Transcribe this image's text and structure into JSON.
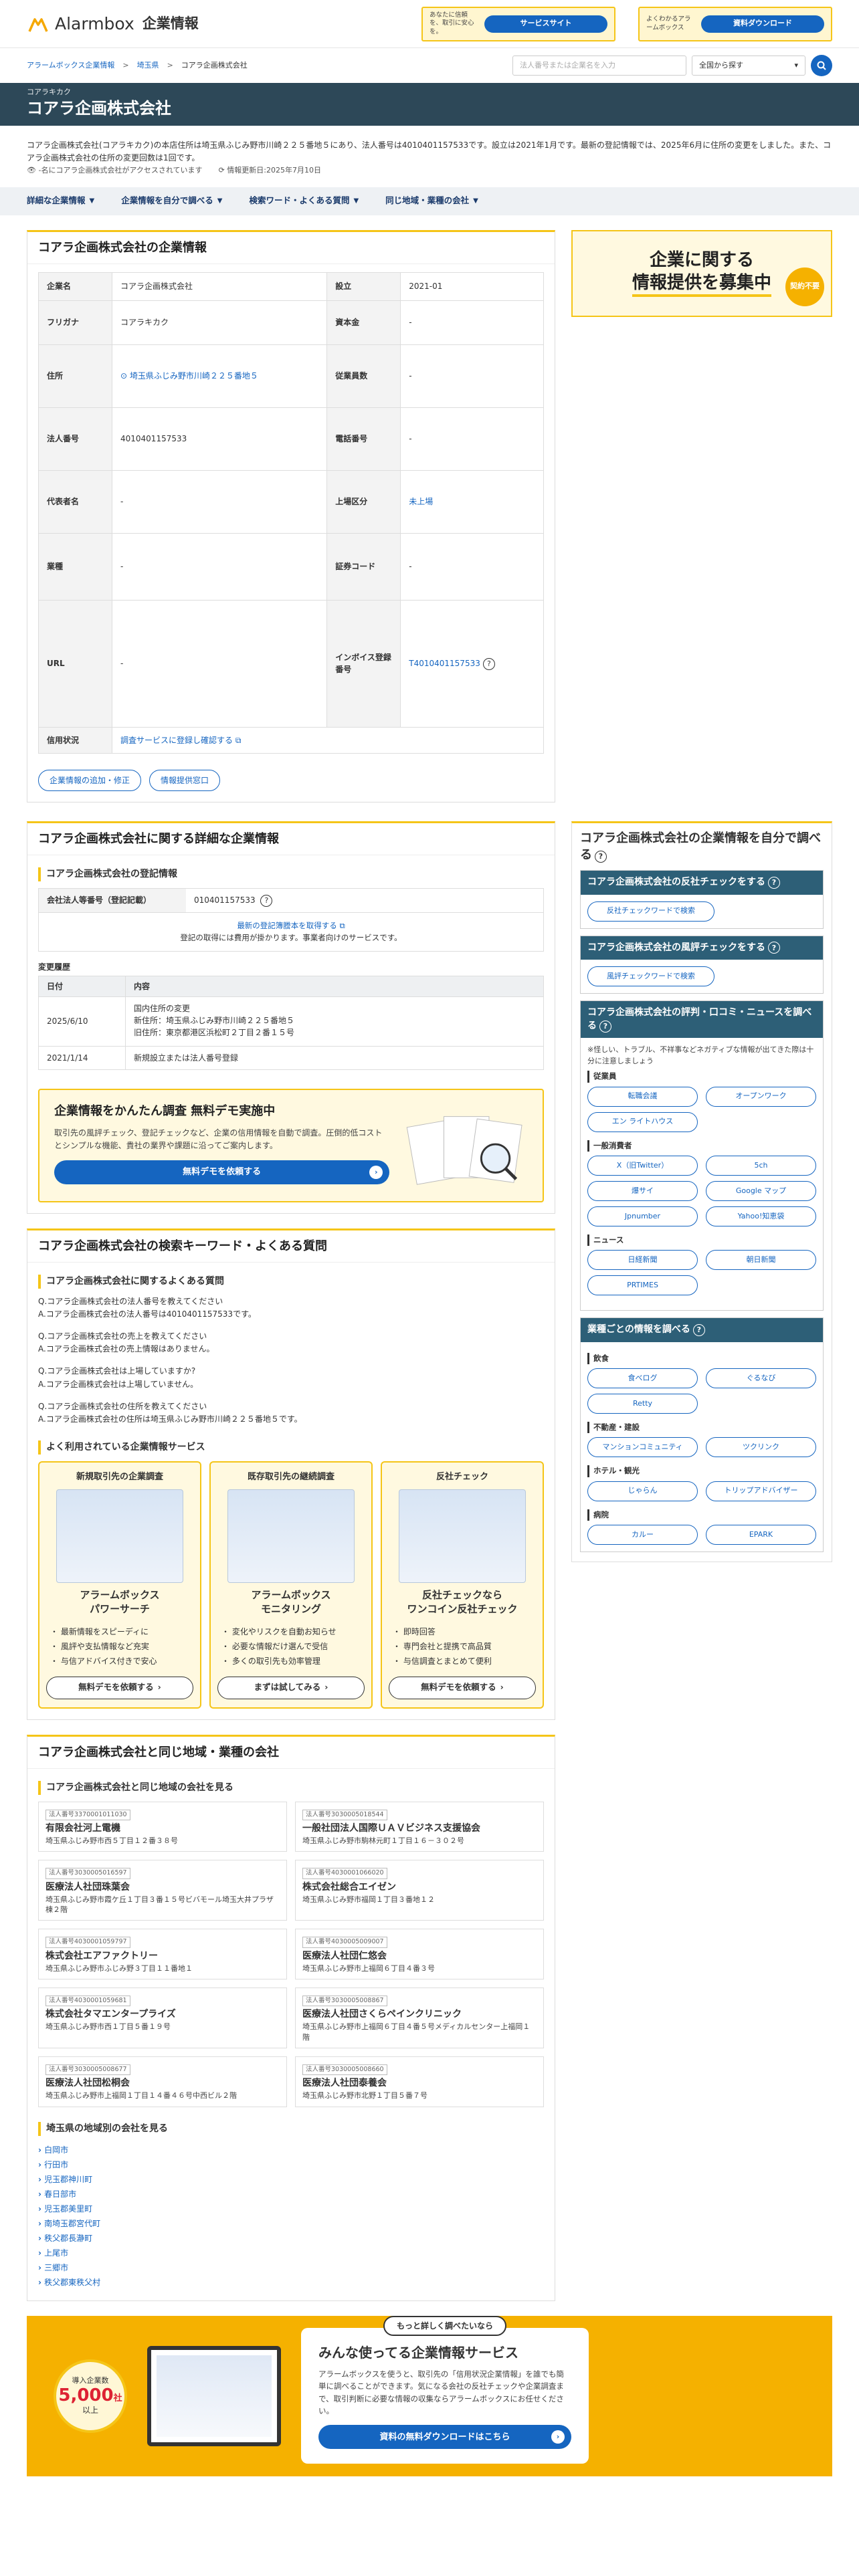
{
  "header": {
    "brand": "Alarmbox",
    "section": "企業情報",
    "banner1_text": "あなたに信頼を、取引に安心を。",
    "banner1_button": "サービスサイト",
    "banner2_text": "よくわかるアラームボックス",
    "banner2_button": "資料ダウンロード"
  },
  "breadcrumb": [
    "アラームボックス企業情報",
    "埼玉県",
    "コアラ企画株式会社"
  ],
  "search": {
    "placeholder": "法人番号または企業名を入力",
    "scope": "全国から探す"
  },
  "company": {
    "kana": "コアラキカク",
    "name": "コアラ企画株式会社"
  },
  "intro": {
    "text": "コアラ企画株式会社(コアラキカク)の本店住所は埼玉県ふじみ野市川崎２２５番地５にあり、法人番号は4010401157533です。設立は2021年1月です。最新の登記情報では、2025年6月に住所の変更をしました。また、コアラ企画株式会社の住所の変更回数は1回です。",
    "views": "-名にコアラ企画株式会社がアクセスされています",
    "updated": "情報更新日:2025年7月10日"
  },
  "tabs": [
    "詳細な企業情報",
    "企業情報を自分で調べる",
    "検索ワード・よくある質問",
    "同じ地域・業種の会社"
  ],
  "info_card": {
    "title": "コアラ企画株式会社の企業情報",
    "rows": [
      {
        "k1": "企業名",
        "v1": "コアラ企画株式会社",
        "k2": "設立",
        "v2": "2021-01"
      },
      {
        "k1": "フリガナ",
        "v1": "コアラキカク",
        "k2": "資本金",
        "v2": "-"
      },
      {
        "k1": "住所",
        "v1": "埼玉県ふじみ野市川崎２２５番地５",
        "k2": "従業員数",
        "v2": "-"
      },
      {
        "k1": "法人番号",
        "v1": "4010401157533",
        "k2": "電話番号",
        "v2": "-"
      },
      {
        "k1": "代表者名",
        "v1": "-",
        "k2": "上場区分",
        "v2": "未上場"
      },
      {
        "k1": "業種",
        "v1": "-",
        "k2": "証券コード",
        "v2": "-"
      },
      {
        "k1": "URL",
        "v1": "-",
        "k2": "インボイス登録番号",
        "v2": "T4010401157533"
      }
    ],
    "credit_label": "信用状況",
    "credit_value": "調査サービスに登録し確認する",
    "buttons": [
      "企業情報の追加・修正",
      "情報提供窓口"
    ]
  },
  "detail_card": {
    "title": "コアラ企画株式会社に関する詳細な企業情報",
    "sub": "コアラ企画株式会社の登記情報",
    "reg_label": "会社法人等番号（登記記載）",
    "reg_value": "010401157533",
    "reg_link": "最新の登記簿謄本を取得する",
    "reg_note": "登記の取得には費用が掛かります。事業者向けのサービスです。",
    "hist_title": "変更履歴",
    "hist_headers": [
      "日付",
      "内容"
    ],
    "history": [
      {
        "date": "2025/6/10",
        "content": "国内住所の変更\n新住所：埼玉県ふじみ野市川崎２２５番地５\n旧住所：東京都港区浜松町２丁目２番１５号"
      },
      {
        "date": "2021/1/14",
        "content": "新規設立または法人番号登録"
      }
    ]
  },
  "promo": {
    "title": "企業情報をかんたん調査 無料デモ実施中",
    "text": "取引先の風評チェック、登記チェックなど、企業の信用情報を自動で調査。圧倒的低コストとシンプルな機能、貴社の業界や課題に沿ってご案内します。",
    "button": "無料デモを依頼する"
  },
  "faq_card": {
    "title": "コアラ企画株式会社の検索キーワード・よくある質問",
    "sub": "コアラ企画株式会社に関するよくある質問",
    "qa": [
      {
        "q": "Q.コアラ企画株式会社の法人番号を教えてください",
        "a": "A.コアラ企画株式会社の法人番号は4010401157533です。"
      },
      {
        "q": "Q.コアラ企画株式会社の売上を教えてください",
        "a": "A.コアラ企画株式会社の売上情報はありません。"
      },
      {
        "q": "Q.コアラ企画株式会社は上場していますか?",
        "a": "A.コアラ企画株式会社は上場していません。"
      },
      {
        "q": "Q.コアラ企画株式会社の住所を教えてください",
        "a": "A.コアラ企画株式会社の住所は埼玉県ふじみ野市川崎２２５番地５です。"
      }
    ],
    "svc_title": "よく利用されている企業情報サービス",
    "services": [
      {
        "tag": "新規取引先の企業調査",
        "name": "アラームボックス\nパワーサーチ",
        "points": [
          "最新情報をスピーディに",
          "風評や支払情報など充実",
          "与信アドバイス付きで安心"
        ],
        "button": "無料デモを依頼する"
      },
      {
        "tag": "既存取引先の継続調査",
        "name": "アラームボックス\nモニタリング",
        "points": [
          "変化やリスクを自動お知らせ",
          "必要な情報だけ選んで受信",
          "多くの取引先も効率管理"
        ],
        "button": "まずは試してみる"
      },
      {
        "tag": "反社チェック",
        "name": "反社チェックなら\nワンコイン反社チェック",
        "points": [
          "即時回答",
          "専門会社と提携で高品質",
          "与信調査とまとめて便利"
        ],
        "button": "無料デモを依頼する"
      }
    ]
  },
  "same_area": {
    "title": "コアラ企画株式会社と同じ地域・業種の会社",
    "sub": "コアラ企画株式会社と同じ地域の会社を見る",
    "companies": [
      {
        "num": "法人番号3370001011030",
        "name": "有限会社河上電機",
        "addr": "埼玉県ふじみ野市西５丁目１２番３８号"
      },
      {
        "num": "法人番号3030005018544",
        "name": "一般社団法人国際ＵＡＶビジネス支援協会",
        "addr": "埼玉県ふじみ野市駒林元町１丁目１６－３０２号"
      },
      {
        "num": "法人番号3030005016597",
        "name": "医療法人社団珠葉会",
        "addr": "埼玉県ふじみ野市霞ケ丘１丁目３番１５号ビバモール埼玉大井プラザ棟２階"
      },
      {
        "num": "法人番号4030001066020",
        "name": "株式会社総合エイゼン",
        "addr": "埼玉県ふじみ野市福岡１丁目３番地１２"
      },
      {
        "num": "法人番号4030001059797",
        "name": "株式会社エアファクトリー",
        "addr": "埼玉県ふじみ野市ふじみ野３丁目１１番地１"
      },
      {
        "num": "法人番号4030005009007",
        "name": "医療法人社団仁悠会",
        "addr": "埼玉県ふじみ野市上福岡６丁目４番３号"
      },
      {
        "num": "法人番号4030001059681",
        "name": "株式会社タマエンタープライズ",
        "addr": "埼玉県ふじみ野市西１丁目５番１９号"
      },
      {
        "num": "法人番号3030005008867",
        "name": "医療法人社団さくらペインクリニック",
        "addr": "埼玉県ふじみ野市上福岡６丁目４番５号メディカルセンター上福岡１階"
      },
      {
        "num": "法人番号3030005008677",
        "name": "医療法人社団松桐会",
        "addr": "埼玉県ふじみ野市上福岡１丁目１４番４６号中西ビル２階"
      },
      {
        "num": "法人番号3030005008660",
        "name": "医療法人社団泰養会",
        "addr": "埼玉県ふじみ野市北野１丁目５番７号"
      }
    ],
    "area_title": "埼玉県の地域別の会社を見る",
    "areas": [
      "白岡市",
      "行田市",
      "児玉郡神川町",
      "春日部市",
      "児玉郡美里町",
      "南埼玉郡宮代町",
      "秩父郡長瀞町",
      "上尾市",
      "三郷市",
      "秩父郡東秩父村"
    ]
  },
  "side": {
    "ad_line1": "企業に関する",
    "ad_line2": "情報提供を募集中",
    "ad_badge": "契約不要",
    "title": "コアラ企画株式会社の企業情報を自分で調べる",
    "box1_title": "コアラ企画株式会社の反社チェックをする",
    "box1_btn": "反社チェックワードで検索",
    "box2_title": "コアラ企画株式会社の風評チェックをする",
    "box2_btn": "風評チェックワードで検索",
    "box3_title": "コアラ企画株式会社の評判・口コミ・ニュースを調べる",
    "box3_note": "※怪しい、トラブル、不祥事などネガティブな情報が出てきた際は十分に注意しましょう",
    "groups": [
      {
        "label": "従業員",
        "items": [
          "転職会議",
          "オープンワーク",
          "エン ライトハウス"
        ]
      },
      {
        "label": "一般消費者",
        "items": [
          "X（旧Twitter）",
          "5ch",
          "爆サイ",
          "Google マップ",
          "Jpnumber",
          "Yahoo!知恵袋"
        ]
      },
      {
        "label": "ニュース",
        "items": [
          "日経新聞",
          "朝日新聞",
          "PRTIMES"
        ]
      }
    ],
    "box4_title": "業種ごとの情報を調べる",
    "groups2": [
      {
        "label": "飲食",
        "items": [
          "食べログ",
          "ぐるなび",
          "Retty"
        ]
      },
      {
        "label": "不動産・建設",
        "items": [
          "マンションコミュニティ",
          "ツクリンク"
        ]
      },
      {
        "label": "ホテル・観光",
        "items": [
          "じゃらん",
          "トリップアドバイザー"
        ]
      },
      {
        "label": "病院",
        "items": [
          "カルー",
          "EPARK"
        ]
      }
    ]
  },
  "cta": {
    "badge_top": "導入企業数",
    "badge_num": "5,000",
    "badge_unit": "社",
    "badge_bottom": "以上",
    "tag": "もっと詳しく調べたいなら",
    "title": "みんな使ってる企業情報サービス",
    "text": "アラームボックスを使うと、取引先の「信用状況企業情報」を誰でも簡単に調べることができます。気になる会社の反社チェックや企業調査まで、取引判断に必要な情報の収集ならアラームボックスにお任せください。",
    "button": "資料の無料ダウンロードはこちら"
  },
  "colors": {
    "accent": "#f5c518",
    "brand": "#1565c0",
    "titlebar": "#2d4858"
  }
}
